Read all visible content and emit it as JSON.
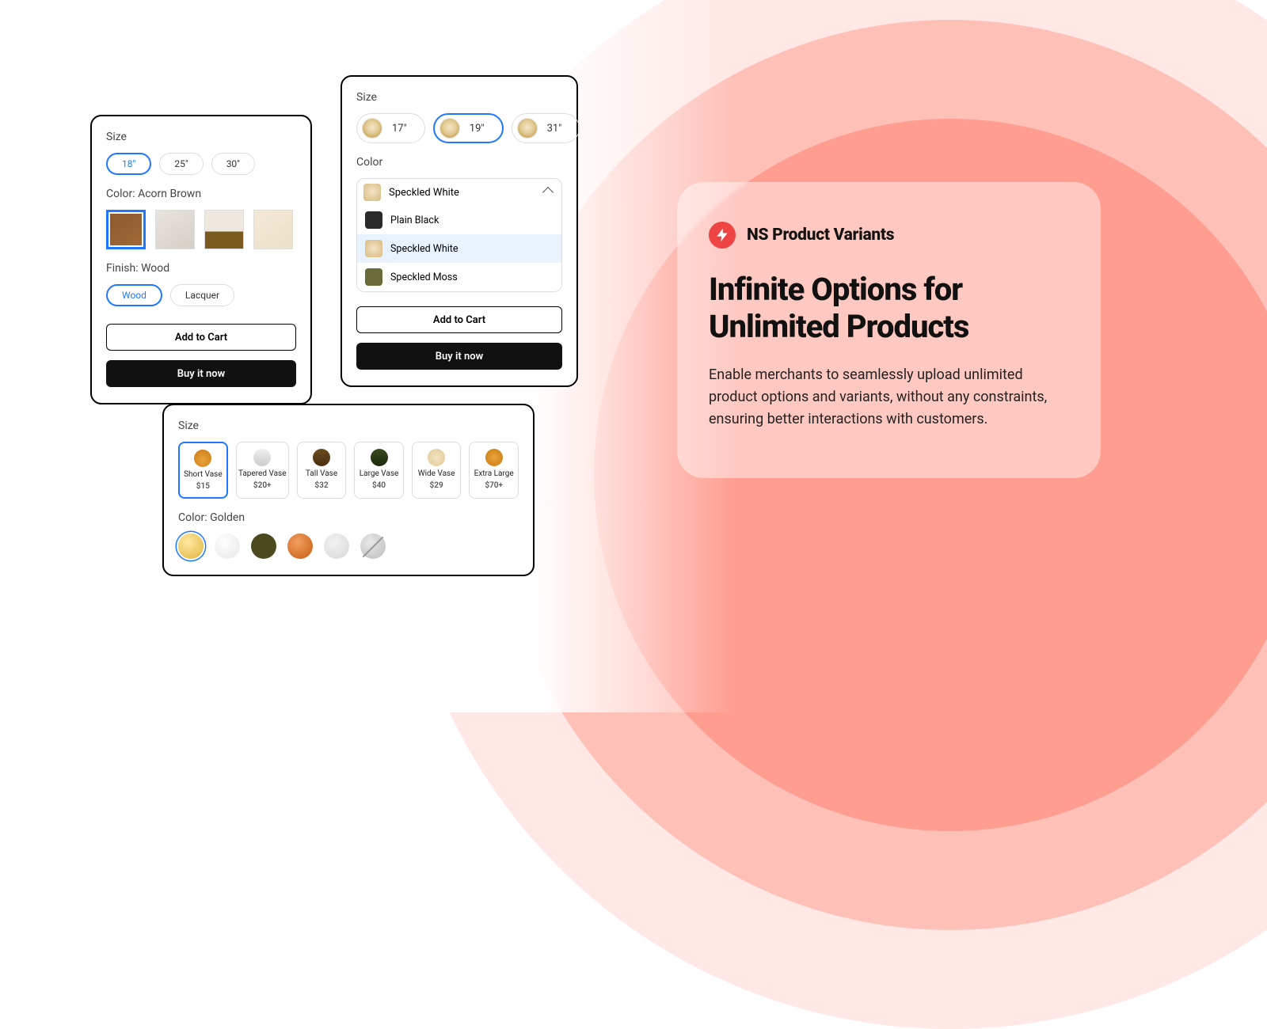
{
  "cardA": {
    "size_label": "Size",
    "sizes": [
      "18\"",
      "25\"",
      "30\""
    ],
    "size_selected": 0,
    "color_label": "Color: Acorn Brown",
    "finish_label": "Finish: Wood",
    "finishes": [
      "Wood",
      "Lacquer"
    ],
    "finish_selected": 0,
    "add_to_cart": "Add to Cart",
    "buy_now": "Buy it now"
  },
  "cardB": {
    "size_label": "Size",
    "sizes": [
      "17\"",
      "19\"",
      "31\""
    ],
    "size_selected": 1,
    "color_label": "Color",
    "dropdown_selected": "Speckled White",
    "options": [
      "Plain Black",
      "Speckled White",
      "Speckled Moss"
    ],
    "option_selected": 1,
    "add_to_cart": "Add to Cart",
    "buy_now": "Buy it now"
  },
  "cardC": {
    "size_label": "Size",
    "tiles": [
      {
        "name": "Short Vase",
        "price": "$15"
      },
      {
        "name": "Tapered Vase",
        "price": "$20+"
      },
      {
        "name": "Tall Vase",
        "price": "$32"
      },
      {
        "name": "Large Vase",
        "price": "$40"
      },
      {
        "name": "Wide Vase",
        "price": "$29"
      },
      {
        "name": "Extra Large",
        "price": "$70+"
      }
    ],
    "tile_selected": 0,
    "color_label": "Color: Golden"
  },
  "panel": {
    "brand": "NS Product Variants",
    "headline": "Infinite Options for Unlimited Products",
    "desc": "Enable merchants to seamlessly upload unlimited product options and variants, without any constraints, ensuring better interactions with customers."
  }
}
